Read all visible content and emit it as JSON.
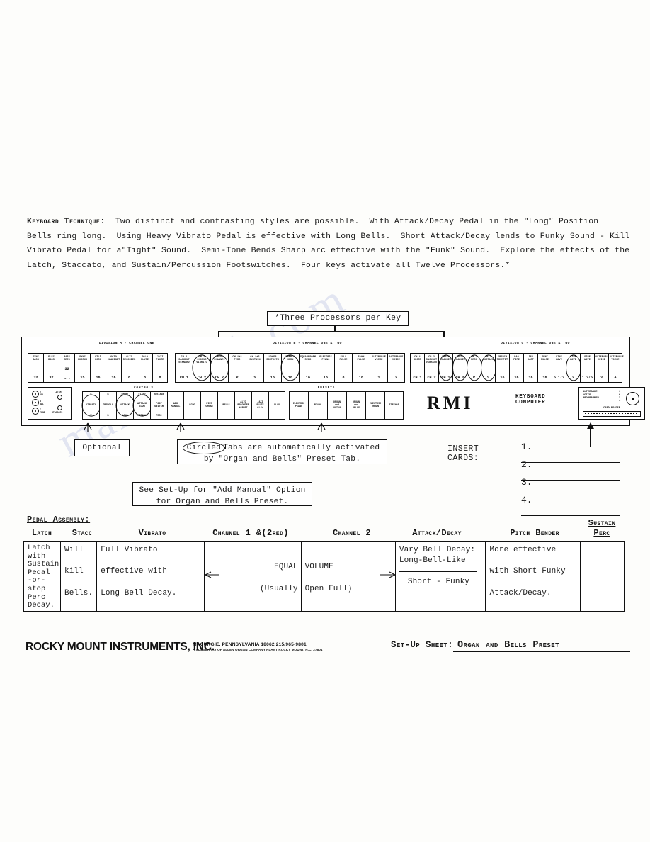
{
  "document": {
    "intro_label": "Keyboard Technique:",
    "intro_text": "  Two distinct and contrasting styles are possible.  With Attack/Decay Pedal in the \"Long\" Position\nBells ring long.  Using Heavy Vibrato Pedal is effective with Long Bells.  Short Attack/Decay lends to Funky Sound - Kill\nVibrato Pedal for a\"Tight\" Sound.  Semi-Tone Bends Sharp arc effective with the \"Funk\" Sound.  Explore the effects of the\nLatch, Staccato, and Sustain/Percussion Footswitches.  Four keys activate all Twelve Processors.*"
  },
  "processors_callout": "*Three Processors per Key",
  "panel": {
    "division_a_label": "DIVISION A - CHANNEL ONE",
    "division_b_label": "DIVISION B - CHANNEL ONE & TWO",
    "division_c_label": "DIVISION C - CHANNEL ONE & TWO",
    "division_a_tabs": [
      {
        "name": "SYNC\nBASS",
        "num": "32"
      },
      {
        "name": "ELEC\nBASS",
        "num": "32"
      },
      {
        "name": "BASS\nREED",
        "num": "32",
        "sub": "DIV C"
      },
      {
        "name": "SYNC\nCHORUS",
        "num": "15"
      },
      {
        "name": "WILD\nHORN",
        "num": "16"
      },
      {
        "name": "OCTO\nCLARINET",
        "num": "16"
      },
      {
        "name": "ALTO\nRECORDER",
        "num": "8"
      },
      {
        "name": "SOLO\nFLUTE",
        "num": "8"
      },
      {
        "name": "JAZZ\nFLUTE",
        "num": "8"
      }
    ],
    "division_b_tabs": [
      {
        "name": "CH 1\nSACKBUT\nSCHNARD",
        "num": "CH 1"
      },
      {
        "name": "CH 2\nCHORUS\nVIBRATO",
        "num": "CH 2",
        "circled": true
      },
      {
        "name": "RED\nCHANNEL",
        "num": "CH 2",
        "circled": true
      },
      {
        "name": "CH 1+2\nPERC",
        "num": "P"
      },
      {
        "name": "CH 1+2\nSUSTAIN",
        "num": "S"
      },
      {
        "name": "LOWER\nSAWTOOTH",
        "num": "16"
      },
      {
        "name": "FRENCH\nHORN",
        "num": "16",
        "circled": true
      },
      {
        "name": "SQUAREFORM\nREED",
        "num": "16"
      },
      {
        "name": "ELECTRIC\nPIANO",
        "num": "16"
      },
      {
        "name": "FULL\nPULSE",
        "num": "8"
      },
      {
        "name": "SAWN\nPULSE",
        "num": "16"
      },
      {
        "name": "ALTERABLE\nVOICE",
        "num": "1"
      },
      {
        "name": "ALTERABLE\nVOICE",
        "num": "2"
      }
    ],
    "division_c_tabs": [
      {
        "name": "CH 1\nSHORT",
        "num": "CH 1"
      },
      {
        "name": "CH 2\nSACKBUT\nVIBRATO",
        "num": "CH 2"
      },
      {
        "name": "GREEN\nCHANNEL",
        "num": "CH 1",
        "circled": true
      },
      {
        "name": "RED\nCHANNEL",
        "num": "CH 2",
        "circled": true
      },
      {
        "name": "CH 2\nPERC",
        "num": "P",
        "circled": true
      },
      {
        "name": "CH 2\nSUSTAIN",
        "num": "S",
        "circled": true
      },
      {
        "name": "FRENCH\nTRUMPET",
        "num": "16"
      },
      {
        "name": "BAG\nPIPE",
        "num": "16"
      },
      {
        "name": "JAW\nHARP",
        "num": "16"
      },
      {
        "name": "SEMI\nPULSE",
        "num": "16"
      },
      {
        "name": "SINE\nWAVE",
        "num": "5 1/3"
      },
      {
        "name": "SINE\nWAVE",
        "num": "2",
        "circled": true
      },
      {
        "name": "SINE\nWAVE",
        "num": "1 3/5"
      },
      {
        "name": "ALTERABLE\nVOICE",
        "num": "3"
      },
      {
        "name": "ALTERABLE\nVOICE",
        "num": "4"
      }
    ],
    "knob_cluster": {
      "labels": [
        "V\nVOL",
        "B\nBAL",
        "T\nTONE",
        "LATCH",
        "STACCATO"
      ]
    },
    "controls_title": "CONTROLS",
    "presets_title": "PRESETS",
    "controls": [
      {
        "a": "C",
        "b": "VIBRATO",
        "c": "V",
        "circled": true
      },
      {
        "a": "B",
        "b": "TREMOLO",
        "c": "B"
      },
      {
        "a": "SHORT",
        "b": "ATTACK",
        "c": "LONG",
        "circled": true
      },
      {
        "a": "FIXED",
        "b": "ATTACK\nSLOW",
        "c": "VARIABLE",
        "circled": true
      },
      {
        "a": "SUSTAIN",
        "b": "FOOT\nSWITCH",
        "c": "PERC"
      },
      {
        "a": "",
        "b": "ADD\nMANUAL",
        "c": ""
      }
    ],
    "presets_left": [
      "ECHO",
      "PIPE\nORGAN",
      "BELLS",
      "ALTO\nRECORDER\nHARPSI",
      "JAZZ\nFLUTE\nCLAV",
      "CLAV"
    ],
    "presets_right": [
      "ELECTRIC\nPIANO",
      "PIANO",
      "ORGAN\nand\nGUITAR",
      "ORGAN\nand\nBELLS",
      "ELECTRIC\nORGAN",
      "STRINGS"
    ],
    "logo": "RMI",
    "logo_sub": "KEYBOARD\nCOMPUTER",
    "voice_programmer": {
      "label": "ALTERABLE\nVOICE\nPROGRAMMER",
      "numbers": "1\n2\n3\n4",
      "slot_label": "CARD READER"
    }
  },
  "callouts": {
    "optional": "Optional",
    "circled_word": "Circled",
    "circled_tabs_line1": "Tabs are automatically activated",
    "circled_tabs_line2": "by \"Organ and Bells\" Preset Tab.",
    "add_manual_line1": "See Set-Up for \"Add Manual\" Option",
    "add_manual_line2": "for Organ and Bells Preset."
  },
  "insert_cards": {
    "label": "INSERT CARDS:",
    "items": [
      "1.",
      "2.",
      "3.",
      "4."
    ]
  },
  "pedal_assembly": {
    "title": "Pedal Assembly:",
    "headers": [
      "Latch",
      "Stacc",
      "Vibrato",
      "Channel 1 &(2red)",
      "Channel 2",
      "Attack/Decay",
      "Pitch Bender",
      "Sustain\nPerc"
    ],
    "cells": {
      "latch": "Latch\nwith\nSustain\nPedal\n-or-\nstop\nPerc\nDecay.",
      "stacc": "Will\n\nkill\n\nBells.",
      "vibrato": "Full Vibrato\n\neffective with\n\nLong Bell Decay.",
      "channel1": "EQUAL",
      "channel1_sub": "(Usually",
      "channel2": "VOLUME",
      "channel2_sub": "Open Full)",
      "attack_decay_line1": "Vary Bell Decay:",
      "attack_decay_line2": "Long-Bell-Like",
      "attack_decay_line3": "Short - Funky",
      "pitch_bender": "More effective\n\nwith Short Funky\n\nAttack/Decay.",
      "sustain_perc": ""
    }
  },
  "footer": {
    "company": "ROCKY MOUNT INSTRUMENTS, INC.",
    "address_line1": "MACUNGIE, PENNSYLVANIA 18062        215/965-9801",
    "address_line2": "A SUBSIDIARY OF ALLEN ORGAN COMPANY    PLANT  ROCKY MOUNT, N.C. 27801",
    "setup_label": "Set-Up Sheet:",
    "setup_value": "Organ and Bells Preset"
  },
  "watermark": "manualslib.com"
}
